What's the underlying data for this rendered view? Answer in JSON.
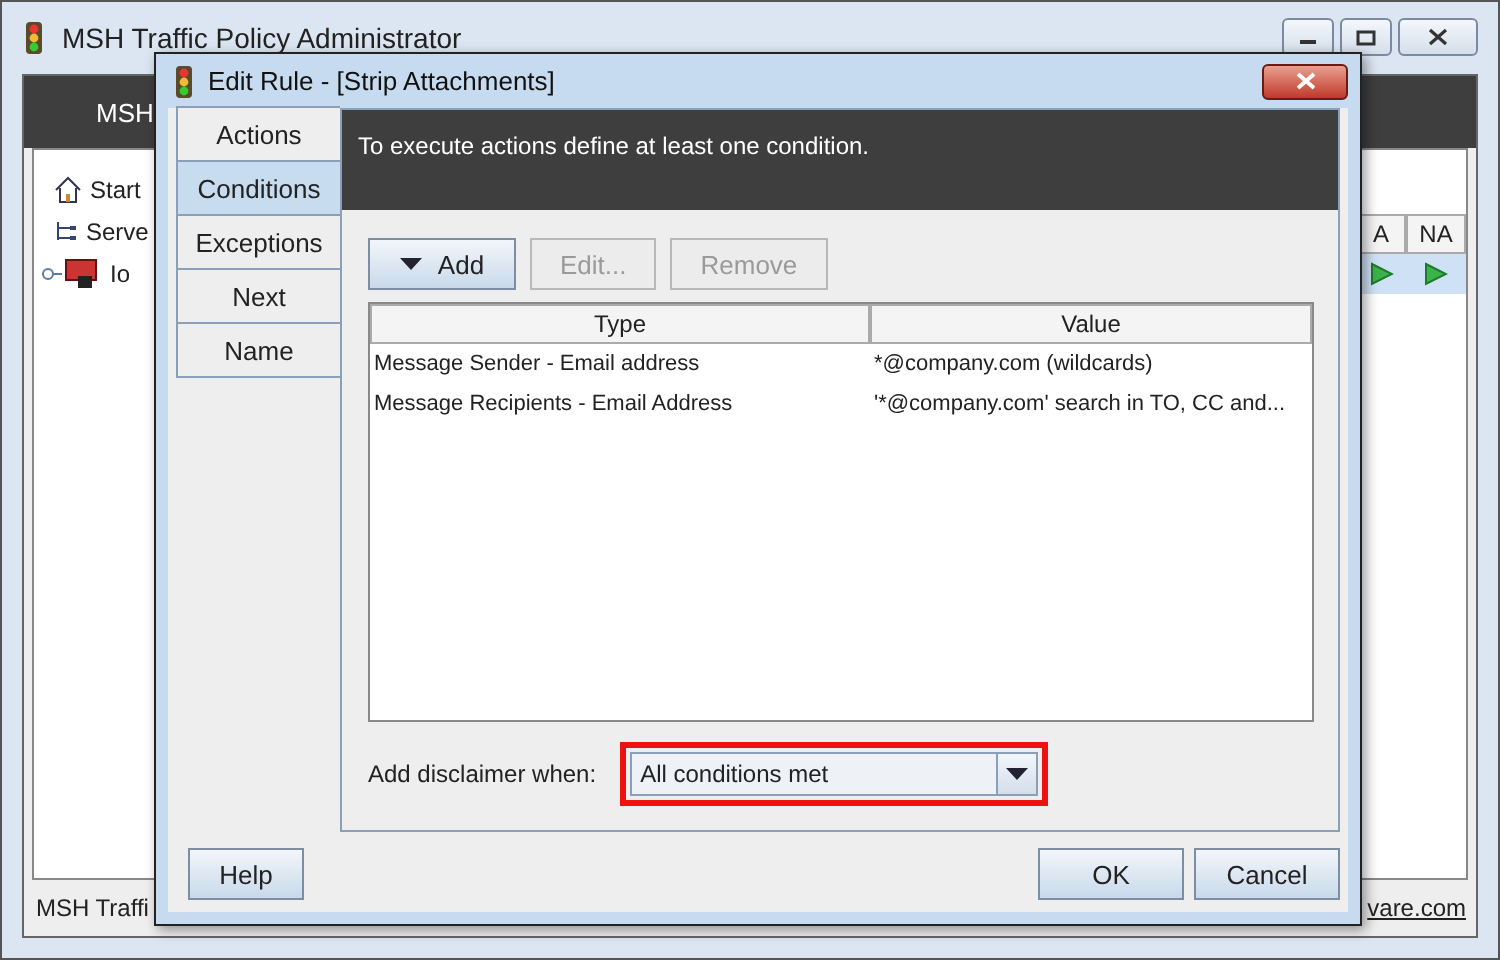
{
  "window": {
    "title": "MSH Traffic Policy Administrator"
  },
  "toolbar": {
    "label": "MSH"
  },
  "tree": [
    {
      "label": "Start",
      "kind": "home"
    },
    {
      "label": "Serve",
      "kind": "servers"
    },
    {
      "label": "Io",
      "kind": "server"
    }
  ],
  "table": {
    "columns": [
      "A",
      "NA"
    ],
    "rows": [
      {
        "selected": true
      }
    ]
  },
  "status_bar": {
    "text": "MSH Traffi",
    "link": "vare.com"
  },
  "dialog": {
    "title": "Edit Rule - [Strip Attachments]",
    "tabs": [
      {
        "label": "Actions",
        "selected": false
      },
      {
        "label": "Conditions",
        "selected": true
      },
      {
        "label": "Exceptions",
        "selected": false
      },
      {
        "label": "Next",
        "selected": false
      },
      {
        "label": "Name",
        "selected": false
      }
    ],
    "info": "To execute actions define at least one condition.",
    "buttons": [
      {
        "label": "Add",
        "kind": "menu",
        "disabled": false
      },
      {
        "label": "Edit...",
        "kind": "plain",
        "disabled": true
      },
      {
        "label": "Remove",
        "kind": "plain",
        "disabled": true
      }
    ],
    "table": {
      "columns": [
        "Type",
        "Value"
      ],
      "rows": [
        [
          "Message Sender - Email address",
          "*@company.com (wildcards)"
        ],
        [
          "Message Recipients - Email Address",
          "'*@company.com' search in TO, CC and..."
        ]
      ]
    },
    "disclaimer": {
      "label": "Add disclaimer when:",
      "value": "All conditions met",
      "highlighted": true
    },
    "footer": {
      "left": [
        "Help"
      ],
      "right": [
        "OK",
        "Cancel"
      ]
    }
  }
}
